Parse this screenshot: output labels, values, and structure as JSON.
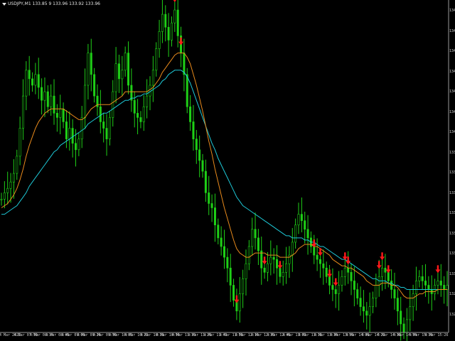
{
  "header": {
    "symbol_line": "USDJPY,M1 133.85 9 133.96 133.92 133.96"
  },
  "colors": {
    "background": "#000000",
    "axis": "#9a9a9a",
    "candles": "#1fd017",
    "ma_fast": "#e88a1c",
    "ma_slow": "#1ec8d6",
    "signal_arrow": "#ff1a1a"
  },
  "chart_data": {
    "type": "candlestick",
    "title": "",
    "y_axis": {
      "side": "right",
      "min": 133.42,
      "max": 134.92,
      "tick_labels": [
        "13490",
        "13477",
        "13463",
        "13450",
        "13436",
        "13422",
        "13408",
        "13394",
        "13380",
        "13366",
        "13352",
        "13338",
        "13324",
        "13310",
        "13296",
        "13282"
      ]
    },
    "x_axis": {
      "tick_labels": [
        "4 Mar 2022",
        "4 Mar 07:50",
        "4 Mar 08:14",
        "4 Mar 08:46",
        "4 Mar 09:00",
        "4 Mar 09:24",
        "4 Mar 09:50",
        "4 Mar 10:00",
        "4 Mar 10:22",
        "4 Mar 10:38",
        "4 Mar 10:54",
        "4 Mar 11:10",
        "4 Mar 11:26",
        "4 Mar 11:42",
        "4 Mar 11:58",
        "4 Mar 12:14",
        "4 Mar 12:30",
        "4 Mar 12:46",
        "4 Mar 13:02",
        "4 Mar 13:18",
        "4 Mar 13:34",
        "4 Mar 13:50",
        "4 Mar 14:06",
        "4 Mar 14:22",
        "4 Mar 14:38",
        "4 Mar 14:54",
        "4 Mar 15:10",
        "4 Mar 15:26"
      ]
    },
    "price_close": [
      134.02,
      134.05,
      134.07,
      134.1,
      134.14,
      134.22,
      134.35,
      134.5,
      134.62,
      134.58,
      134.55,
      134.6,
      134.54,
      134.48,
      134.52,
      134.45,
      134.5,
      134.42,
      134.4,
      134.44,
      134.38,
      134.3,
      134.35,
      134.28,
      134.25,
      134.3,
      134.4,
      134.55,
      134.7,
      134.6,
      134.5,
      134.45,
      134.38,
      134.35,
      134.3,
      134.4,
      134.52,
      134.65,
      134.58,
      134.62,
      134.7,
      134.55,
      134.48,
      134.42,
      134.4,
      134.38,
      134.45,
      134.5,
      134.55,
      134.62,
      134.72,
      134.8,
      134.88,
      134.82,
      134.76,
      134.84,
      134.9,
      134.78,
      134.7,
      134.6,
      134.45,
      134.38,
      134.3,
      134.25,
      134.2,
      134.15,
      134.05,
      134.0,
      133.98,
      133.9,
      133.84,
      133.8,
      133.75,
      133.7,
      133.62,
      133.55,
      133.5,
      133.58,
      133.65,
      133.72,
      133.8,
      133.88,
      133.84,
      133.78,
      133.7,
      133.68,
      133.72,
      133.75,
      133.74,
      133.7,
      133.66,
      133.68,
      133.72,
      133.76,
      133.82,
      133.9,
      133.95,
      133.92,
      133.88,
      133.84,
      133.8,
      133.76,
      133.74,
      133.72,
      133.7,
      133.66,
      133.62,
      133.6,
      133.58,
      133.62,
      133.66,
      133.7,
      133.68,
      133.64,
      133.6,
      133.56,
      133.52,
      133.5,
      133.48,
      133.52,
      133.56,
      133.62,
      133.66,
      133.7,
      133.68,
      133.64,
      133.6,
      133.56,
      133.5,
      133.44,
      133.4,
      133.46,
      133.52,
      133.58,
      133.64,
      133.66,
      133.64,
      133.62,
      133.6,
      133.58,
      133.62,
      133.64,
      133.62,
      133.6,
      133.62
    ],
    "ma_fast": [
      133.98,
      133.99,
      134.0,
      134.02,
      134.04,
      134.07,
      134.11,
      134.16,
      134.22,
      134.27,
      134.31,
      134.35,
      134.38,
      134.4,
      134.42,
      134.43,
      134.44,
      134.44,
      134.44,
      134.44,
      134.44,
      134.43,
      134.42,
      134.41,
      134.4,
      134.39,
      134.39,
      134.4,
      134.42,
      134.44,
      134.45,
      134.46,
      134.46,
      134.46,
      134.46,
      134.46,
      134.47,
      134.48,
      134.49,
      134.5,
      134.52,
      134.52,
      134.52,
      134.52,
      134.52,
      134.52,
      134.52,
      134.52,
      134.53,
      134.54,
      134.56,
      134.58,
      134.61,
      134.63,
      134.65,
      134.67,
      134.69,
      134.7,
      134.7,
      134.7,
      134.68,
      134.65,
      134.6,
      134.55,
      134.49,
      134.43,
      134.36,
      134.29,
      134.23,
      134.16,
      134.1,
      134.04,
      133.98,
      133.93,
      133.88,
      133.83,
      133.79,
      133.77,
      133.76,
      133.75,
      133.75,
      133.76,
      133.77,
      133.77,
      133.77,
      133.77,
      133.76,
      133.76,
      133.76,
      133.76,
      133.75,
      133.75,
      133.75,
      133.75,
      133.76,
      133.77,
      133.79,
      133.8,
      133.81,
      133.81,
      133.81,
      133.8,
      133.8,
      133.79,
      133.78,
      133.77,
      133.76,
      133.74,
      133.73,
      133.72,
      133.71,
      133.71,
      133.7,
      133.7,
      133.69,
      133.68,
      133.67,
      133.66,
      133.64,
      133.63,
      133.62,
      133.62,
      133.62,
      133.63,
      133.63,
      133.63,
      133.62,
      133.62,
      133.61,
      133.59,
      133.57,
      133.56,
      133.56,
      133.56,
      133.57,
      133.58,
      133.58,
      133.59,
      133.59,
      133.59,
      133.59,
      133.6,
      133.6,
      133.6,
      133.6
    ],
    "ma_slow": [
      133.95,
      133.95,
      133.96,
      133.97,
      133.98,
      133.99,
      134.01,
      134.03,
      134.05,
      134.08,
      134.1,
      134.12,
      134.14,
      134.16,
      134.18,
      134.2,
      134.22,
      134.24,
      134.25,
      134.27,
      134.28,
      134.29,
      134.3,
      134.31,
      134.32,
      134.33,
      134.34,
      134.35,
      134.37,
      134.38,
      134.39,
      134.4,
      134.41,
      134.42,
      134.42,
      134.43,
      134.44,
      134.45,
      134.46,
      134.47,
      134.48,
      134.48,
      134.49,
      134.49,
      134.5,
      134.5,
      134.51,
      134.51,
      134.52,
      134.53,
      134.54,
      134.55,
      134.57,
      134.58,
      134.6,
      134.61,
      134.62,
      134.62,
      134.62,
      134.61,
      134.59,
      134.56,
      134.52,
      134.48,
      134.44,
      134.4,
      134.36,
      134.32,
      134.28,
      134.25,
      134.21,
      134.18,
      134.15,
      134.12,
      134.09,
      134.06,
      134.03,
      134.01,
      133.99,
      133.98,
      133.97,
      133.96,
      133.95,
      133.94,
      133.93,
      133.92,
      133.91,
      133.9,
      133.89,
      133.88,
      133.87,
      133.86,
      133.85,
      133.85,
      133.84,
      133.84,
      133.84,
      133.84,
      133.83,
      133.83,
      133.82,
      133.82,
      133.81,
      133.8,
      133.8,
      133.79,
      133.78,
      133.77,
      133.76,
      133.75,
      133.74,
      133.74,
      133.73,
      133.72,
      133.71,
      133.7,
      133.69,
      133.68,
      133.67,
      133.66,
      133.65,
      133.65,
      133.64,
      133.64,
      133.64,
      133.63,
      133.63,
      133.62,
      133.62,
      133.61,
      133.61,
      133.6,
      133.6,
      133.6,
      133.6,
      133.6,
      133.6,
      133.6,
      133.6,
      133.6,
      133.6,
      133.6,
      133.6,
      133.6,
      133.6
    ],
    "sell_signals_index": [
      56,
      58,
      76,
      85,
      90,
      101,
      103,
      106,
      108,
      111,
      112,
      122,
      123,
      125,
      141
    ]
  }
}
